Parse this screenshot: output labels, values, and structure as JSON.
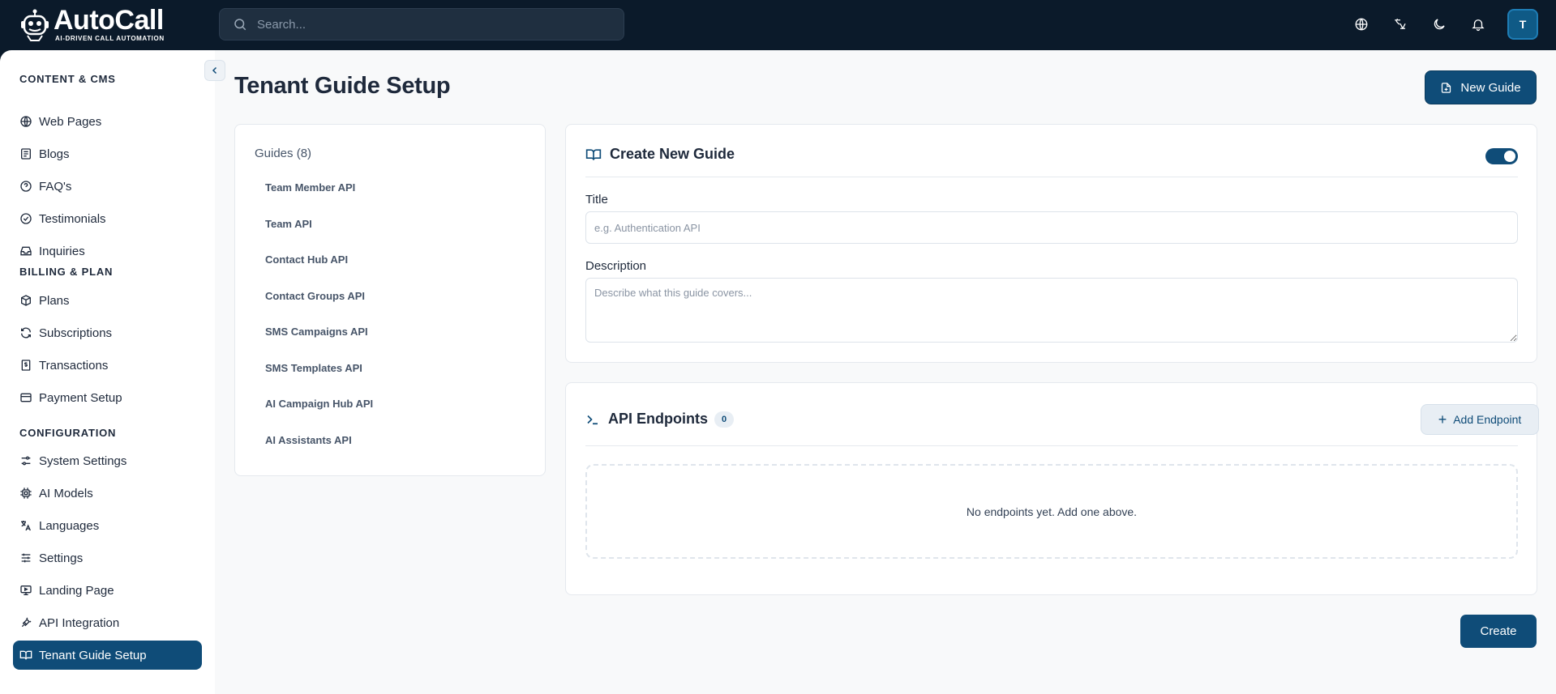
{
  "brand": {
    "name_part1": "Auto",
    "name_part2": "Call",
    "tagline": "AI-DRIVEN CALL AUTOMATION"
  },
  "search": {
    "placeholder": "Search..."
  },
  "topbar": {
    "avatar_initial": "T",
    "icons": [
      "globe-icon",
      "translate-icon",
      "moon-icon",
      "bell-icon"
    ]
  },
  "sidebar": {
    "sections": [
      {
        "title": "CONTENT & CMS",
        "items": [
          {
            "label": "Web Pages",
            "icon": "globe-icon"
          },
          {
            "label": "Blogs",
            "icon": "newspaper-icon"
          },
          {
            "label": "FAQ's",
            "icon": "help-circle-icon"
          },
          {
            "label": "Testimonials",
            "icon": "check-circle-icon"
          },
          {
            "label": "Inquiries",
            "icon": "inbox-icon"
          }
        ]
      },
      {
        "title": "BILLING & PLAN",
        "items": [
          {
            "label": "Plans",
            "icon": "package-icon"
          },
          {
            "label": "Subscriptions",
            "icon": "refresh-icon"
          },
          {
            "label": "Transactions",
            "icon": "receipt-icon"
          },
          {
            "label": "Payment Setup",
            "icon": "credit-card-icon"
          }
        ]
      },
      {
        "title": "CONFIGURATION",
        "items": [
          {
            "label": "System Settings",
            "icon": "settings-sliders-icon"
          },
          {
            "label": "AI Models",
            "icon": "cpu-icon"
          },
          {
            "label": "Languages",
            "icon": "languages-icon"
          },
          {
            "label": "Settings",
            "icon": "sliders-icon"
          },
          {
            "label": "Landing Page",
            "icon": "monitor-icon"
          },
          {
            "label": "API Integration",
            "icon": "plug-icon"
          },
          {
            "label": "Tenant Guide Setup",
            "icon": "book-open-icon",
            "active": true
          }
        ]
      }
    ]
  },
  "page": {
    "title": "Tenant Guide Setup",
    "new_guide_label": "New Guide"
  },
  "guides": {
    "header": "Guides (8)",
    "items": [
      "Team Member API",
      "Team API",
      "Contact Hub API",
      "Contact Groups API",
      "SMS Campaigns API",
      "SMS Templates API",
      "AI Campaign Hub API",
      "AI Assistants API"
    ]
  },
  "create_guide": {
    "heading": "Create New Guide",
    "toggle_on": true,
    "title_label": "Title",
    "title_placeholder": "e.g. Authentication API",
    "title_value": "",
    "description_label": "Description",
    "description_placeholder": "Describe what this guide covers...",
    "description_value": ""
  },
  "endpoints": {
    "heading": "API Endpoints",
    "count": "0",
    "add_label": "Add Endpoint",
    "empty_text": "No endpoints yet. Add one above."
  },
  "footer": {
    "create_label": "Create"
  },
  "colors": {
    "primary": "#0f4c78",
    "topbar_bg": "#0b1a2a",
    "page_bg": "#f8f9fa"
  }
}
